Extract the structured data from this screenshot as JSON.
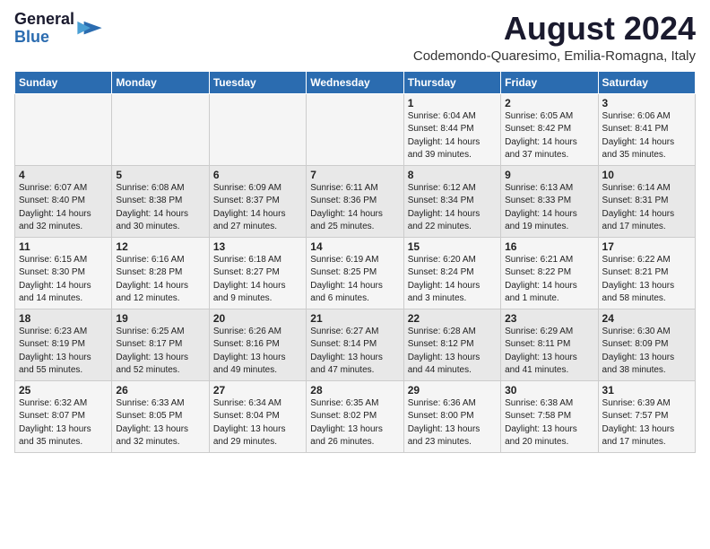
{
  "header": {
    "logo_general": "General",
    "logo_blue": "Blue",
    "month_title": "August 2024",
    "location": "Codemondo-Quaresimo, Emilia-Romagna, Italy"
  },
  "days_of_week": [
    "Sunday",
    "Monday",
    "Tuesday",
    "Wednesday",
    "Thursday",
    "Friday",
    "Saturday"
  ],
  "weeks": [
    [
      {
        "day": "",
        "info": ""
      },
      {
        "day": "",
        "info": ""
      },
      {
        "day": "",
        "info": ""
      },
      {
        "day": "",
        "info": ""
      },
      {
        "day": "1",
        "info": "Sunrise: 6:04 AM\nSunset: 8:44 PM\nDaylight: 14 hours\nand 39 minutes."
      },
      {
        "day": "2",
        "info": "Sunrise: 6:05 AM\nSunset: 8:42 PM\nDaylight: 14 hours\nand 37 minutes."
      },
      {
        "day": "3",
        "info": "Sunrise: 6:06 AM\nSunset: 8:41 PM\nDaylight: 14 hours\nand 35 minutes."
      }
    ],
    [
      {
        "day": "4",
        "info": "Sunrise: 6:07 AM\nSunset: 8:40 PM\nDaylight: 14 hours\nand 32 minutes."
      },
      {
        "day": "5",
        "info": "Sunrise: 6:08 AM\nSunset: 8:38 PM\nDaylight: 14 hours\nand 30 minutes."
      },
      {
        "day": "6",
        "info": "Sunrise: 6:09 AM\nSunset: 8:37 PM\nDaylight: 14 hours\nand 27 minutes."
      },
      {
        "day": "7",
        "info": "Sunrise: 6:11 AM\nSunset: 8:36 PM\nDaylight: 14 hours\nand 25 minutes."
      },
      {
        "day": "8",
        "info": "Sunrise: 6:12 AM\nSunset: 8:34 PM\nDaylight: 14 hours\nand 22 minutes."
      },
      {
        "day": "9",
        "info": "Sunrise: 6:13 AM\nSunset: 8:33 PM\nDaylight: 14 hours\nand 19 minutes."
      },
      {
        "day": "10",
        "info": "Sunrise: 6:14 AM\nSunset: 8:31 PM\nDaylight: 14 hours\nand 17 minutes."
      }
    ],
    [
      {
        "day": "11",
        "info": "Sunrise: 6:15 AM\nSunset: 8:30 PM\nDaylight: 14 hours\nand 14 minutes."
      },
      {
        "day": "12",
        "info": "Sunrise: 6:16 AM\nSunset: 8:28 PM\nDaylight: 14 hours\nand 12 minutes."
      },
      {
        "day": "13",
        "info": "Sunrise: 6:18 AM\nSunset: 8:27 PM\nDaylight: 14 hours\nand 9 minutes."
      },
      {
        "day": "14",
        "info": "Sunrise: 6:19 AM\nSunset: 8:25 PM\nDaylight: 14 hours\nand 6 minutes."
      },
      {
        "day": "15",
        "info": "Sunrise: 6:20 AM\nSunset: 8:24 PM\nDaylight: 14 hours\nand 3 minutes."
      },
      {
        "day": "16",
        "info": "Sunrise: 6:21 AM\nSunset: 8:22 PM\nDaylight: 14 hours\nand 1 minute."
      },
      {
        "day": "17",
        "info": "Sunrise: 6:22 AM\nSunset: 8:21 PM\nDaylight: 13 hours\nand 58 minutes."
      }
    ],
    [
      {
        "day": "18",
        "info": "Sunrise: 6:23 AM\nSunset: 8:19 PM\nDaylight: 13 hours\nand 55 minutes."
      },
      {
        "day": "19",
        "info": "Sunrise: 6:25 AM\nSunset: 8:17 PM\nDaylight: 13 hours\nand 52 minutes."
      },
      {
        "day": "20",
        "info": "Sunrise: 6:26 AM\nSunset: 8:16 PM\nDaylight: 13 hours\nand 49 minutes."
      },
      {
        "day": "21",
        "info": "Sunrise: 6:27 AM\nSunset: 8:14 PM\nDaylight: 13 hours\nand 47 minutes."
      },
      {
        "day": "22",
        "info": "Sunrise: 6:28 AM\nSunset: 8:12 PM\nDaylight: 13 hours\nand 44 minutes."
      },
      {
        "day": "23",
        "info": "Sunrise: 6:29 AM\nSunset: 8:11 PM\nDaylight: 13 hours\nand 41 minutes."
      },
      {
        "day": "24",
        "info": "Sunrise: 6:30 AM\nSunset: 8:09 PM\nDaylight: 13 hours\nand 38 minutes."
      }
    ],
    [
      {
        "day": "25",
        "info": "Sunrise: 6:32 AM\nSunset: 8:07 PM\nDaylight: 13 hours\nand 35 minutes."
      },
      {
        "day": "26",
        "info": "Sunrise: 6:33 AM\nSunset: 8:05 PM\nDaylight: 13 hours\nand 32 minutes."
      },
      {
        "day": "27",
        "info": "Sunrise: 6:34 AM\nSunset: 8:04 PM\nDaylight: 13 hours\nand 29 minutes."
      },
      {
        "day": "28",
        "info": "Sunrise: 6:35 AM\nSunset: 8:02 PM\nDaylight: 13 hours\nand 26 minutes."
      },
      {
        "day": "29",
        "info": "Sunrise: 6:36 AM\nSunset: 8:00 PM\nDaylight: 13 hours\nand 23 minutes."
      },
      {
        "day": "30",
        "info": "Sunrise: 6:38 AM\nSunset: 7:58 PM\nDaylight: 13 hours\nand 20 minutes."
      },
      {
        "day": "31",
        "info": "Sunrise: 6:39 AM\nSunset: 7:57 PM\nDaylight: 13 hours\nand 17 minutes."
      }
    ]
  ]
}
